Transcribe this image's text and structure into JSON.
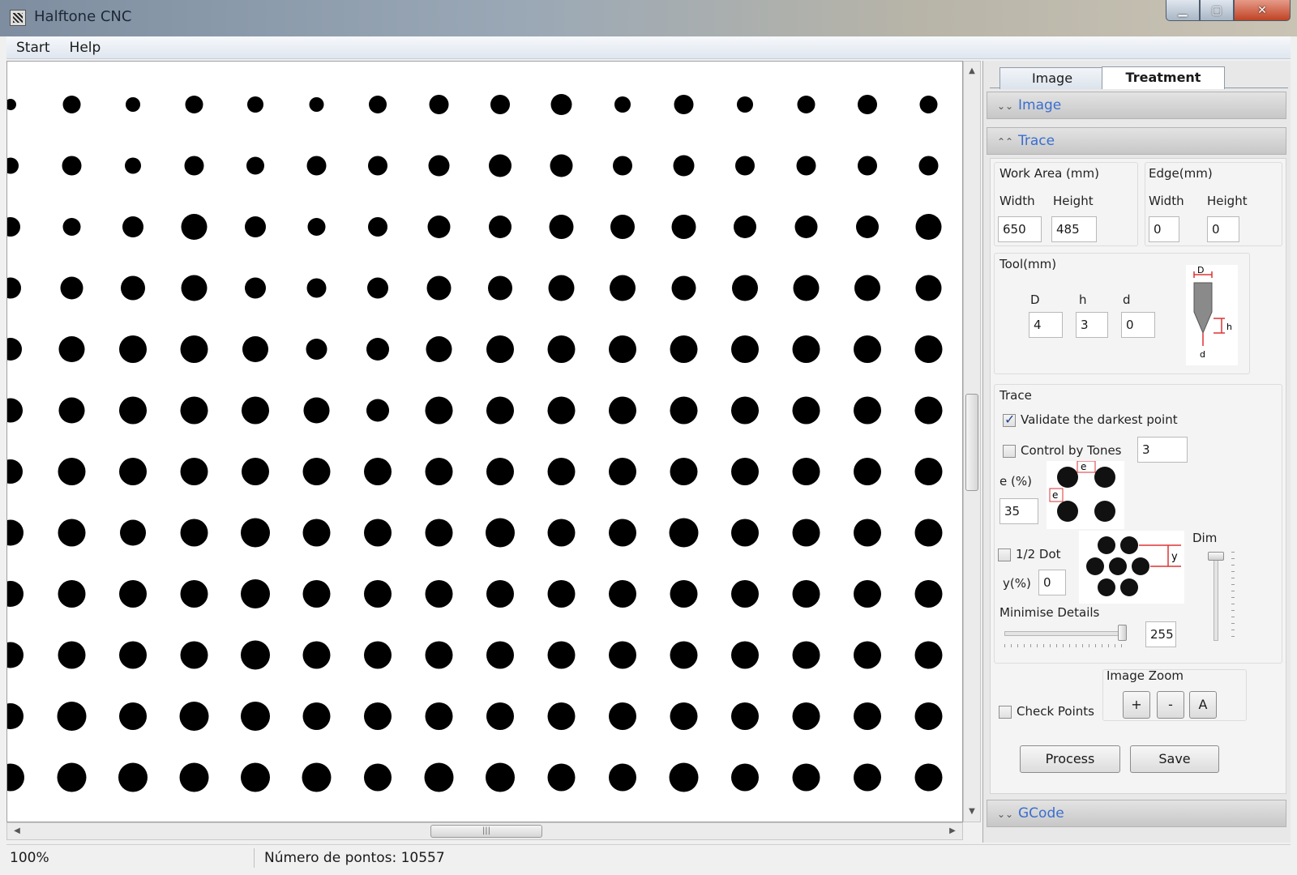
{
  "window": {
    "title": "Halftone CNC",
    "min": "▁",
    "max": "▢",
    "close": "✕"
  },
  "menu": {
    "start": "Start",
    "help": "Help"
  },
  "canvas": {
    "dot_color": "#000000"
  },
  "status": {
    "zoom": "100%",
    "points": "Número de pontos: 10557"
  },
  "panel": {
    "tabs": {
      "image": "Image",
      "treatment": "Treatment"
    },
    "sections": {
      "image": "Image",
      "trace": "Trace",
      "gcode": "GCode"
    },
    "work_area": {
      "title": "Work Area (mm)",
      "width_label": "Width",
      "height_label": "Height",
      "width": "650",
      "height": "485"
    },
    "edge": {
      "title": "Edge(mm)",
      "width_label": "Width",
      "height_label": "Height",
      "width": "0",
      "height": "0"
    },
    "tool": {
      "title": "Tool(mm)",
      "D_label": "D",
      "h_label": "h",
      "d_label": "d",
      "D": "4",
      "h": "3",
      "d": "0",
      "diagram_D": "D",
      "diagram_h": "h",
      "diagram_d": "d"
    },
    "trace": {
      "title": "Trace",
      "validate_darkest": "Validate the darkest point",
      "validate_checked": true,
      "control_by_tones": "Control by Tones",
      "tones_value": "3",
      "e_label": "e (%)",
      "e_value": "35",
      "e_diagram": "e",
      "half_dot": "1/2 Dot",
      "y_label": "y(%)",
      "y_value": "0",
      "y_diagram": "y",
      "dim_label": "Dim",
      "minimise_label": "Minimise Details",
      "minimise_value": "255",
      "check_points": "Check Points",
      "zoom_title": "Image Zoom",
      "zoom_plus": "+",
      "zoom_minus": "-",
      "zoom_auto": "A",
      "process": "Process",
      "save": "Save"
    }
  }
}
